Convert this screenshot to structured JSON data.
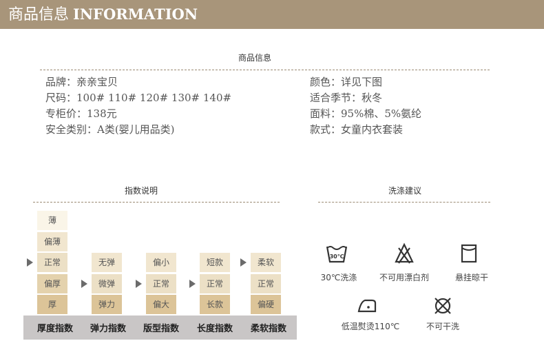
{
  "header": {
    "title_cn": "商品信息",
    "title_en": "INFORMATION"
  },
  "product": {
    "section_title": "商品信息",
    "left": [
      "品牌：亲亲宝贝",
      "尺码：100# 110# 120# 130# 140#",
      "专柜价：138元",
      "安全类别：A类(婴儿用品类)"
    ],
    "right": [
      "颜色：详见下图",
      "适合季节：秋冬",
      "面料：95%棉、5%氨纶",
      "款式：女童内衣套装"
    ]
  },
  "index": {
    "section_title": "指数说明",
    "columns": [
      {
        "label": "厚度指数",
        "options": [
          "薄",
          "偏薄",
          "正常",
          "偏厚",
          "厚"
        ],
        "selected": 2
      },
      {
        "label": "弹力指数",
        "options": [
          "无弹",
          "微弹",
          "弹力"
        ],
        "selected": 1
      },
      {
        "label": "版型指数",
        "options": [
          "偏小",
          "正常",
          "偏大"
        ],
        "selected": 1
      },
      {
        "label": "长度指数",
        "options": [
          "短款",
          "正常",
          "长款"
        ],
        "selected": 1
      },
      {
        "label": "柔软指数",
        "options": [
          "柔软",
          "正常",
          "偏硬"
        ],
        "selected": 0
      }
    ]
  },
  "wash": {
    "section_title": "洗涤建议",
    "items": [
      {
        "icon": "wash-30-icon",
        "label": "30℃洗涤"
      },
      {
        "icon": "no-bleach-icon",
        "label": "不可用漂白剂"
      },
      {
        "icon": "hang-dry-icon",
        "label": "悬挂晾干"
      },
      {
        "icon": "iron-low-icon",
        "label": "低温熨烫110℃"
      },
      {
        "icon": "no-dry-clean-icon",
        "label": "不可干洗"
      }
    ],
    "wash_temp_text": "30℃"
  },
  "colors": {
    "header": "#a8957a",
    "dotline": "#9a8a72",
    "base_bar": "#c9c6c6"
  }
}
